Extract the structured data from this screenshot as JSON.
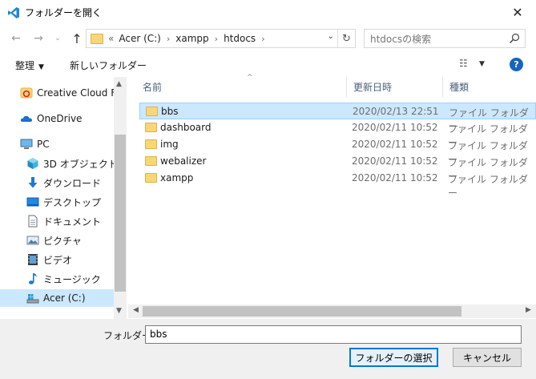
{
  "window": {
    "title": "フォルダーを開く",
    "close_glyph": "✕"
  },
  "nav": {
    "back_glyph": "←",
    "forward_glyph": "→",
    "recent_glyph": "⌄",
    "up_glyph": "↑",
    "breadcrumb_overflow": "«",
    "breadcrumbs": [
      "Acer (C:)",
      "xampp",
      "htdocs"
    ],
    "crumb_sep": "›",
    "refresh_glyph": "↻",
    "dropdown_glyph": "⌄"
  },
  "search": {
    "placeholder": "htdocsの検索"
  },
  "toolbar": {
    "organize_label": "整理",
    "organize_caret": "▼",
    "new_folder_label": "新しいフォルダー",
    "view_glyph": "☷",
    "view_caret": "▼",
    "help_label": "?"
  },
  "sidebar": {
    "items": [
      {
        "label": "Creative Cloud File",
        "icon": "creative-cloud-icon"
      },
      {
        "label": "OneDrive",
        "icon": "onedrive-icon"
      },
      {
        "label": "PC",
        "icon": "pc-icon"
      },
      {
        "label": "3D オブジェクト",
        "icon": "3d-objects-icon"
      },
      {
        "label": "ダウンロード",
        "icon": "download-icon"
      },
      {
        "label": "デスクトップ",
        "icon": "desktop-icon"
      },
      {
        "label": "ドキュメント",
        "icon": "documents-icon"
      },
      {
        "label": "ピクチャ",
        "icon": "pictures-icon"
      },
      {
        "label": "ビデオ",
        "icon": "videos-icon"
      },
      {
        "label": "ミュージック",
        "icon": "music-icon"
      },
      {
        "label": "Acer (C:)",
        "icon": "drive-icon",
        "selected": true
      }
    ],
    "scroll_up_glyph": "▲",
    "scroll_down_glyph": "▼"
  },
  "filelist": {
    "columns": [
      "名前",
      "更新日時",
      "種類"
    ],
    "sort_glyph": "^",
    "rows": [
      {
        "name": "bbs",
        "date": "2020/02/13 22:51",
        "type": "ファイル フォルダー",
        "selected": true
      },
      {
        "name": "dashboard",
        "date": "2020/02/11 10:52",
        "type": "ファイル フォルダー"
      },
      {
        "name": "img",
        "date": "2020/02/11 10:52",
        "type": "ファイル フォルダー"
      },
      {
        "name": "webalizer",
        "date": "2020/02/11 10:52",
        "type": "ファイル フォルダー"
      },
      {
        "name": "xampp",
        "date": "2020/02/11 10:52",
        "type": "ファイル フォルダー"
      }
    ],
    "scroll_left_glyph": "◀",
    "scroll_right_glyph": "▶"
  },
  "footer": {
    "folder_label": "フォルダー:",
    "folder_value": "bbs",
    "select_button": "フォルダーの選択",
    "cancel_button": "キャンセル"
  },
  "colors": {
    "selection": "#cce8ff",
    "folder": "#f8d775",
    "accent": "#0078d7",
    "help": "#1565c0"
  }
}
